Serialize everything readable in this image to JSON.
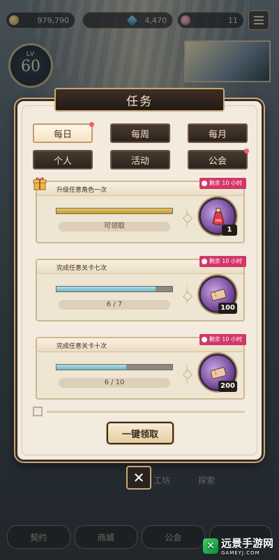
{
  "resources": {
    "gold": "979,790",
    "gems": "4,470",
    "tickets": "11"
  },
  "player": {
    "level_label": "LV",
    "level": "60"
  },
  "dialog": {
    "title": "任务",
    "tabs": [
      {
        "label": "每日",
        "active": true,
        "badge": true
      },
      {
        "label": "每周",
        "active": false,
        "badge": false
      },
      {
        "label": "每月",
        "active": false,
        "badge": false
      },
      {
        "label": "个人",
        "active": false,
        "badge": false
      },
      {
        "label": "活动",
        "active": false,
        "badge": false
      },
      {
        "label": "公会",
        "active": false,
        "badge": true
      }
    ],
    "tasks": [
      {
        "title": "升级任意角色一次",
        "remaining": "剩余 10 小时",
        "progress_text": "可领取",
        "progress": 1.0,
        "bar_color": "gold",
        "reward_count": "1",
        "reward_icon": "potion-icon"
      },
      {
        "title": "完成任意关卡七次",
        "remaining": "剩余 10 小时",
        "progress_text": "6 / 7",
        "progress": 0.857,
        "bar_color": "blue",
        "reward_count": "100",
        "reward_icon": "ticket-icon"
      },
      {
        "title": "完成任意关卡十次",
        "remaining": "剩余 10 小时",
        "progress_text": "6 / 10",
        "progress": 0.6,
        "bar_color": "blue",
        "reward_count": "200",
        "reward_icon": "ticket-icon"
      }
    ],
    "claim_all_label": "一键领取",
    "close_label": "✕"
  },
  "background": {
    "hex_labels": [
      "工坊",
      "探索"
    ],
    "bottom_nav": [
      "契约",
      "商城",
      "公会",
      ""
    ]
  },
  "watermark": {
    "name": "远景手游网",
    "domain": "GAMEYJ.COM"
  },
  "colors": {
    "accent_pink": "#d23768",
    "panel_bg": "#f2ebde",
    "dark_frame": "#3b2d24"
  }
}
